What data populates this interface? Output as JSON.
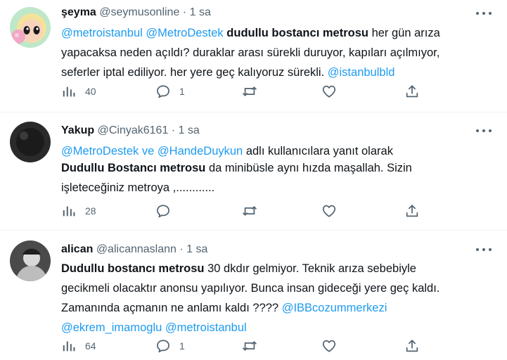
{
  "tweets": [
    {
      "name": "şeyma",
      "handle": "@seymusonline",
      "dot": "·",
      "time": "1 sa",
      "line1": {
        "mention1": "@metroistanbul",
        "mention2": "@MetroDestek",
        "bold": "dudullu bostancı metrosu",
        "text": "her gün arıza"
      },
      "line2": "yapacaksa neden açıldı? duraklar arası sürekli duruyor, kapıları açılmıyor,",
      "line3": {
        "text": "seferler iptal ediliyor. her yere geç kalıyoruz sürekli.",
        "mention": "@istanbulbld"
      },
      "stats": {
        "views": "40",
        "replies": "1"
      }
    },
    {
      "name": "Yakup",
      "handle": "@Cinyak6161",
      "dot": "·",
      "time": "1 sa",
      "reply": {
        "mention1": "@MetroDestek",
        "and": "ve",
        "mention2": "@HandeDuykun",
        "suffix": "adlı kullanıcılara yanıt olarak"
      },
      "line1": {
        "bold": "Dudullu Bostancı metrosu",
        "text": "da minibüsle aynı hızda maşallah. Sizin"
      },
      "line2": "işleteceğiniz metroya ,............",
      "stats": {
        "views": "28"
      }
    },
    {
      "name": "alican",
      "handle": "@alicannaslann",
      "dot": "·",
      "time": "1 sa",
      "line1": {
        "bold": "Dudullu bostancı metrosu",
        "text": "30 dkdır gelmiyor. Teknik arıza sebebiyle"
      },
      "line2": "gecikmeli olacaktır anonsu yapılıyor. Bunca insan gideceği yere geç kaldı.",
      "line3": {
        "text": "Zamanında açmanın ne anlamı kaldı ????",
        "mention": "@IBBcozummerkezi"
      },
      "line4": {
        "mention1": "@ekrem_imamoglu",
        "mention2": "@metroistanbul"
      },
      "stats": {
        "views": "64",
        "replies": "1"
      }
    }
  ],
  "icons": [
    "views-icon",
    "reply-icon",
    "retweet-icon",
    "like-icon",
    "share-icon",
    "more-icon"
  ],
  "colors": {
    "link": "#1d9bf0",
    "text": "#0f1419",
    "muted": "#536471",
    "divider": "#eff3f4"
  }
}
